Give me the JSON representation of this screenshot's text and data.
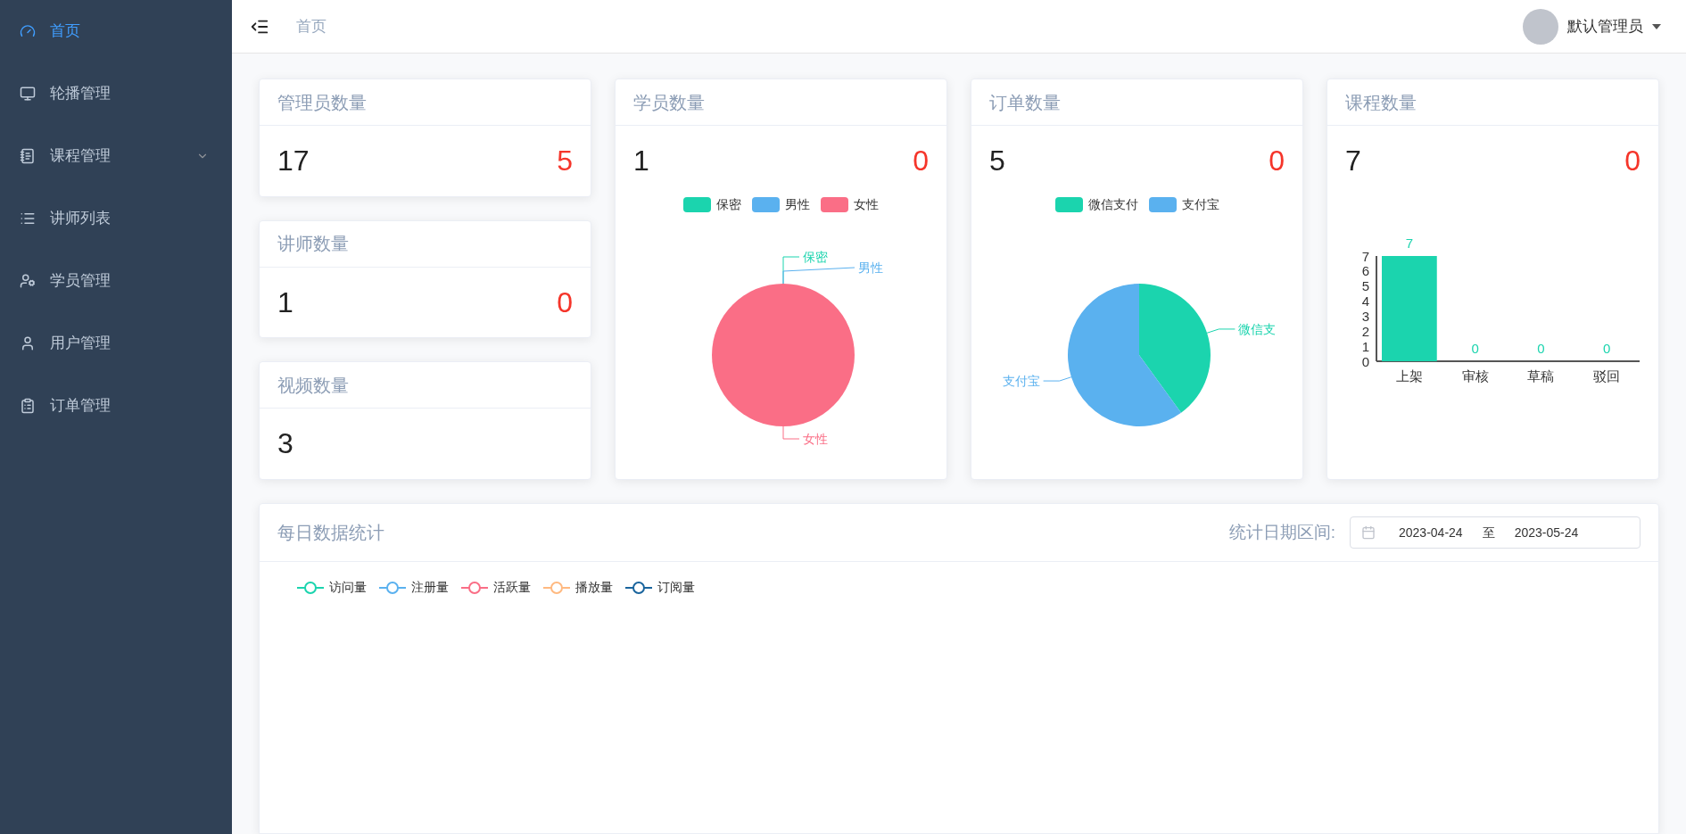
{
  "sidebar": {
    "items": [
      {
        "label": "首页",
        "kind": "item",
        "selected": true
      },
      {
        "label": "轮播管理",
        "kind": "item",
        "selected": false
      },
      {
        "label": "课程管理",
        "kind": "submenu",
        "selected": false
      },
      {
        "label": "讲师列表",
        "kind": "item",
        "selected": false
      },
      {
        "label": "学员管理",
        "kind": "item",
        "selected": false
      },
      {
        "label": "用户管理",
        "kind": "item",
        "selected": false
      },
      {
        "label": "订单管理",
        "kind": "item",
        "selected": false
      }
    ]
  },
  "header": {
    "breadcrumb": "首页",
    "user": "默认管理员"
  },
  "small_cards": [
    {
      "title": "管理员数量",
      "total": "17",
      "new": "5"
    },
    {
      "title": "讲师数量",
      "total": "1",
      "new": "0"
    },
    {
      "title": "视频数量",
      "total": "3"
    }
  ],
  "chart_cards": [
    {
      "title": "学员数量",
      "total": "1",
      "new": "0",
      "legend": [
        {
          "label": "保密",
          "color": "#1bd4ae"
        },
        {
          "label": "男性",
          "color": "#5ab1ef"
        },
        {
          "label": "女性",
          "color": "#fa6e86"
        }
      ],
      "chart_data": {
        "type": "pie",
        "categories": [
          "保密",
          "男性",
          "女性"
        ],
        "values": [
          0,
          0,
          1
        ]
      }
    },
    {
      "title": "订单数量",
      "total": "5",
      "new": "0",
      "legend": [
        {
          "label": "微信支付",
          "color": "#1bd4ae"
        },
        {
          "label": "支付宝",
          "color": "#5ab1ef"
        }
      ],
      "chart_data": {
        "type": "pie",
        "categories": [
          "微信支",
          "支付宝"
        ],
        "values": [
          40,
          60
        ]
      }
    },
    {
      "title": "课程数量",
      "total": "7",
      "new": "0",
      "chart_data": {
        "type": "bar",
        "categories": [
          "上架",
          "审核",
          "草稿",
          "驳回"
        ],
        "series": [
          {
            "color": "#1bd4ae",
            "values": [
              7,
              0,
              0,
              0
            ]
          }
        ],
        "ylim": [
          0,
          7
        ],
        "yticks": [
          0,
          1,
          2,
          3,
          4,
          5,
          6,
          7
        ],
        "data_labels": true
      }
    }
  ],
  "daily": {
    "title": "每日数据统计",
    "range_label": "统计日期区间:",
    "start": "2023-04-24",
    "separator": "至",
    "end": "2023-05-24",
    "legend": [
      {
        "label": "访问量",
        "color": "#1bd4ae"
      },
      {
        "label": "注册量",
        "color": "#5ab1ef"
      },
      {
        "label": "活跃量",
        "color": "#fa6e86"
      },
      {
        "label": "播放量",
        "color": "#ffb980"
      },
      {
        "label": "订阅量",
        "color": "#19649d"
      }
    ]
  }
}
